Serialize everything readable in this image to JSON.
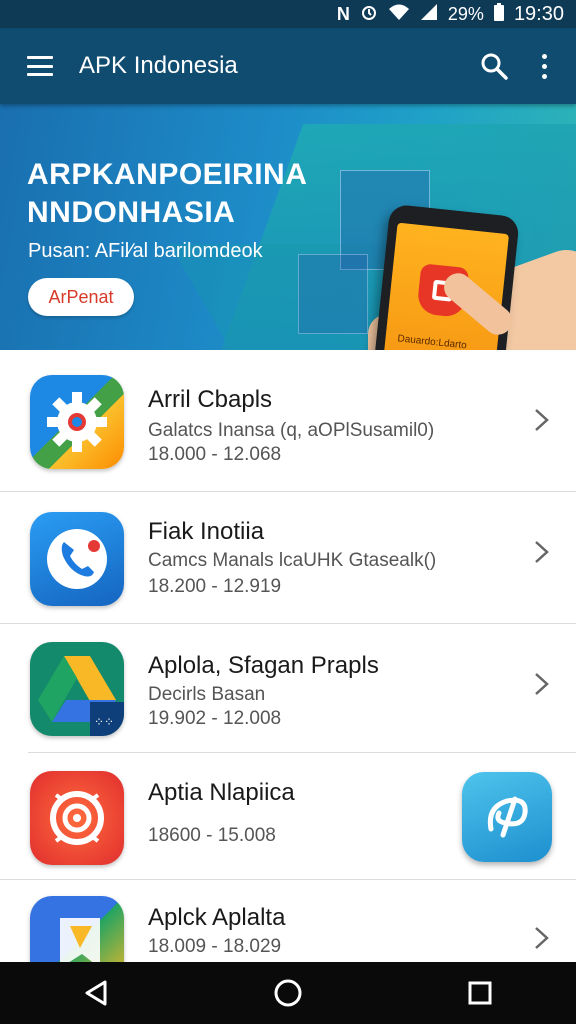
{
  "status_bar": {
    "time": "19:30",
    "battery": "29%",
    "icons": [
      "nfc-icon",
      "alarm-icon",
      "wifi-icon",
      "signal-icon",
      "battery-icon"
    ]
  },
  "app_bar": {
    "title": "APK Indonesia",
    "icons": [
      "menu-icon",
      "search-icon",
      "more-vert-icon"
    ]
  },
  "banner": {
    "title_line1": "ARPKANPOEIRINA",
    "title_line2": "NNDONHASIA",
    "subtitle": "Pusan: AFil∕al barilomdeok",
    "button_label": "ArPenat",
    "phone_text1": "Dauardo:Ldarto",
    "phone_text2": "■ ■ ■ ■ ■ ■ ■"
  },
  "apps": [
    {
      "title": "Arril Cbapls",
      "subtitle": "Galatcs Inansa (q, aOPlSusamil0)",
      "meta": "18.000 - 12.068",
      "icon": "gear-icon"
    },
    {
      "title": "Fiak Inotiia",
      "subtitle": "Camcs Manals lcaUHK Gtasealk()",
      "meta": "18.200 - 12.919",
      "icon": "phone-icon"
    },
    {
      "title": "Aplola, Sfagan Prapls",
      "subtitle": "Decirls Basan",
      "meta": "19.902 - 12.008",
      "icon": "drive-icon"
    },
    {
      "title": "Aptia Nlapiica",
      "subtitle": "",
      "meta": "18600 - 15.008",
      "icon": "target-icon"
    },
    {
      "title": "Aplck Aplalta",
      "subtitle": "",
      "meta": "18.009 - 18.029",
      "icon": "flag-icon"
    }
  ],
  "colors": {
    "app_bar": "#0f4c70",
    "status_bar": "#0e3a56",
    "banner_start": "#1a6fb0",
    "banner_end": "#2fb6b3",
    "button_text": "#d83a2a"
  },
  "nav_bar": {
    "icons": [
      "back-icon",
      "home-icon",
      "recents-icon"
    ]
  }
}
